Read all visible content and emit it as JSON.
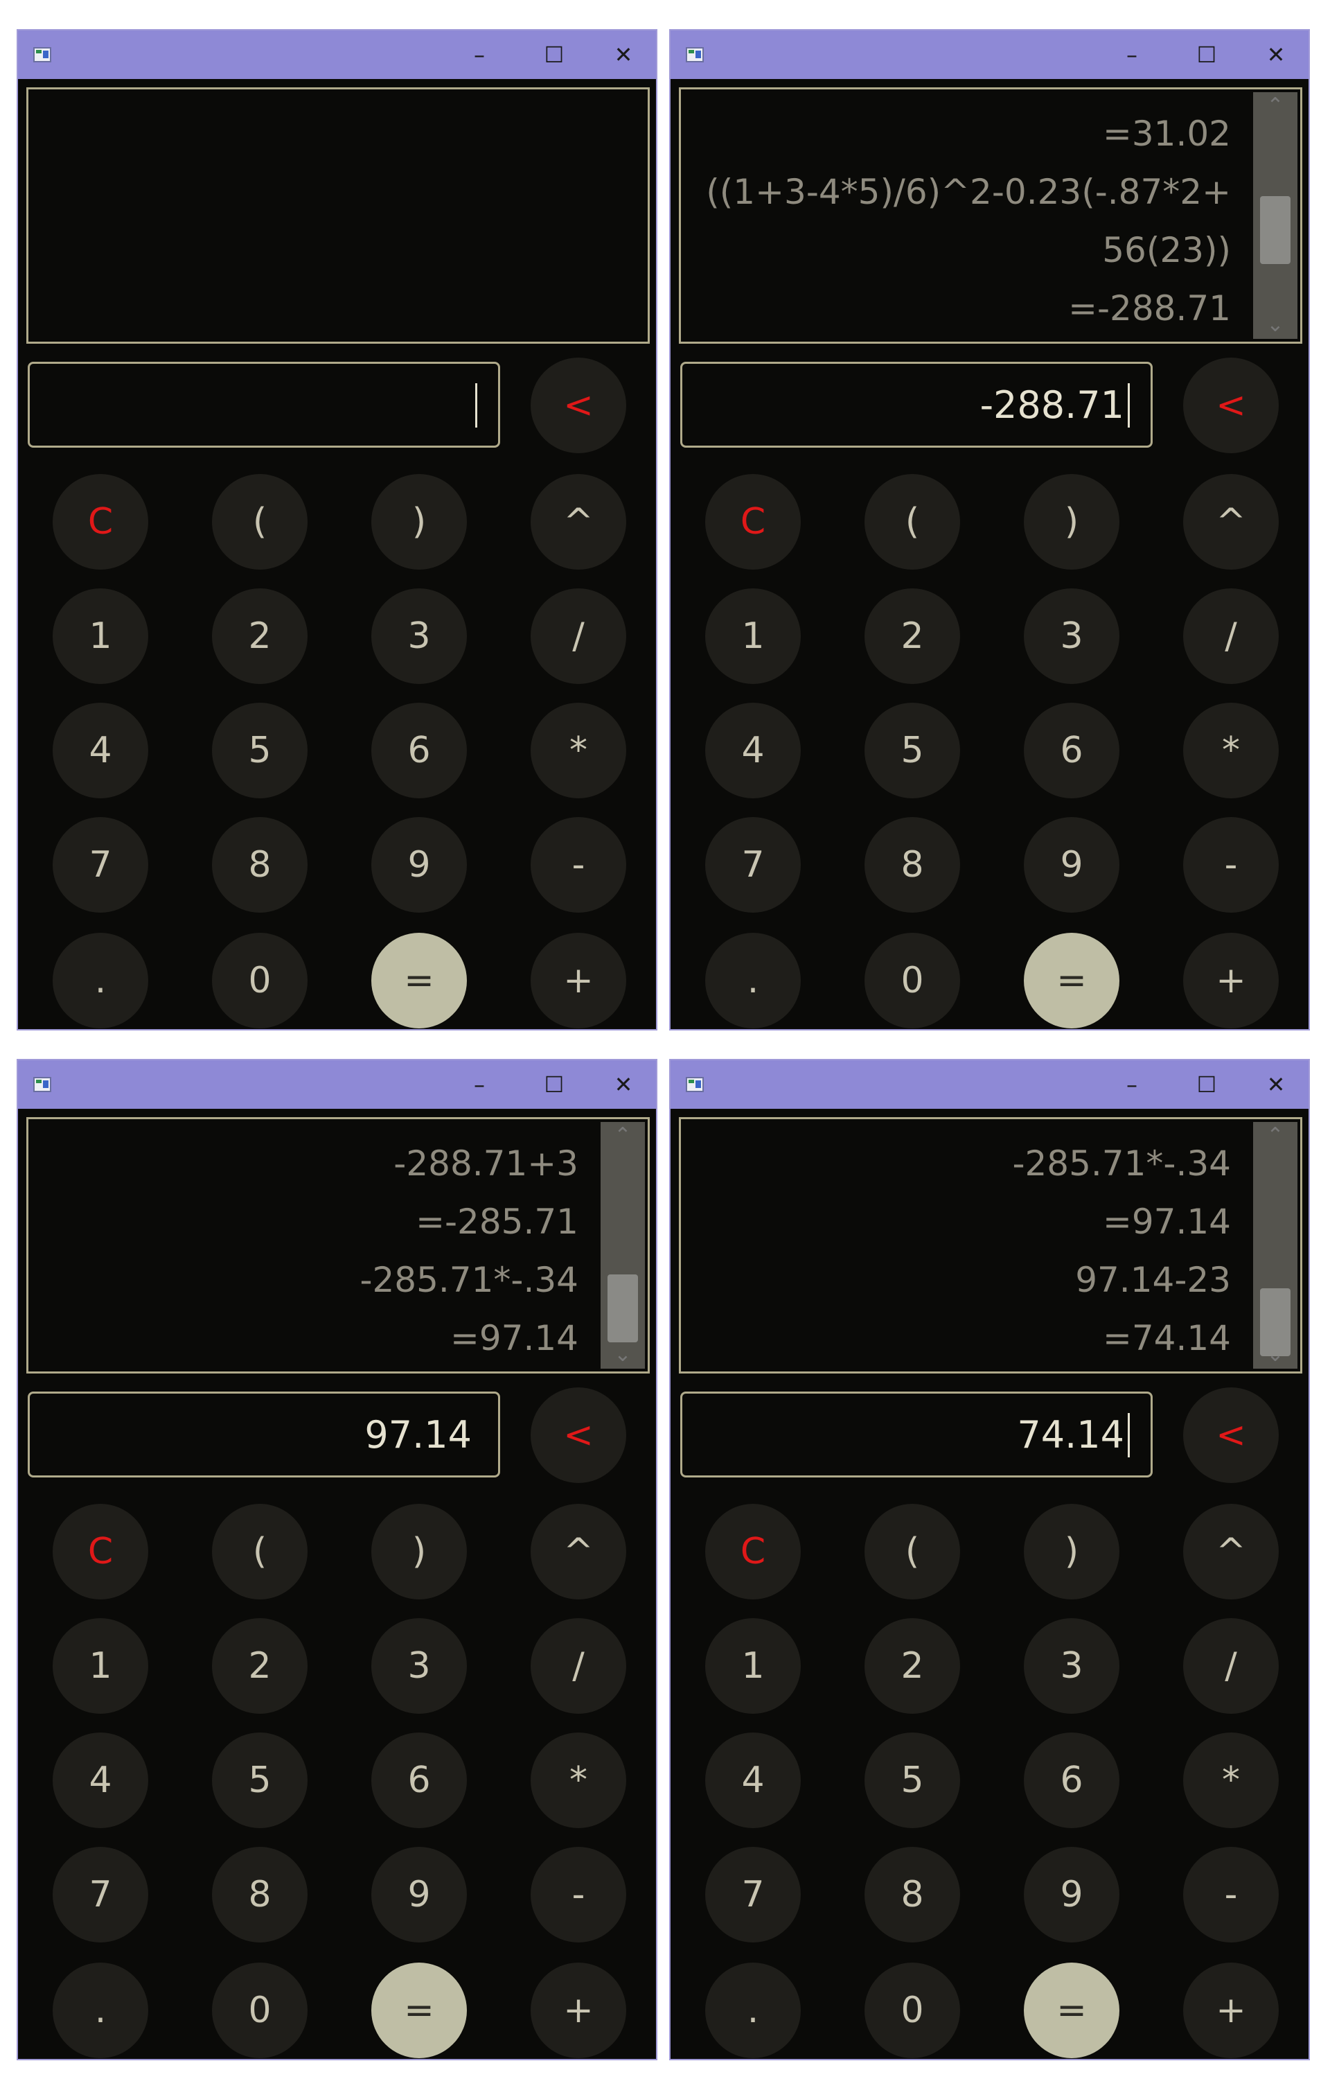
{
  "titlebar": {
    "minimize": "–",
    "maximize": "☐",
    "close": "✕"
  },
  "keys": {
    "backspace": "<",
    "clear": "C",
    "lparen": "(",
    "rparen": ")",
    "power": "^",
    "one": "1",
    "two": "2",
    "three": "3",
    "divide": "/",
    "four": "4",
    "five": "5",
    "six": "6",
    "multiply": "*",
    "seven": "7",
    "eight": "8",
    "nine": "9",
    "minus": "-",
    "decimal": ".",
    "zero": "0",
    "equals": "=",
    "plus": "+"
  },
  "windows": [
    {
      "history": [],
      "display": ""
    },
    {
      "history": [
        "=31.02",
        "((1+3-4*5)/6)^2-0.23(-.87*2+",
        "56(23))",
        "=-288.71"
      ],
      "display": "-288.71"
    },
    {
      "history": [
        "-288.71+3",
        "=-285.71",
        "-285.71*-.34",
        "=97.14"
      ],
      "display": "97.14"
    },
    {
      "history": [
        "-285.71*-.34",
        "=97.14",
        "97.14-23",
        "=74.14"
      ],
      "display": "74.14"
    }
  ],
  "colors": {
    "titlebar": "#8e89d6",
    "background": "#0a0a08",
    "key": "#1f1e1a",
    "equals_key": "#bfbea5",
    "accent_red": "#e01818",
    "border": "#b0aa8a"
  }
}
